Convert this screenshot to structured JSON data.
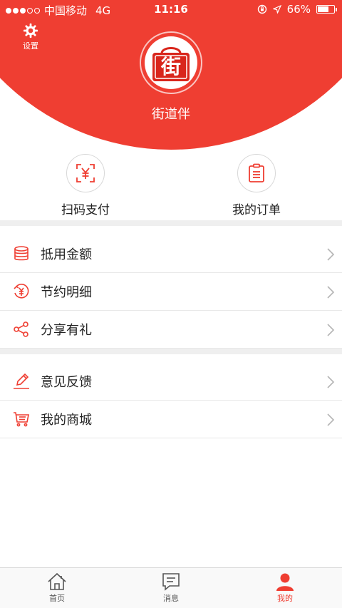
{
  "status_bar": {
    "carrier": "中国移动",
    "network": "4G",
    "time": "11:16",
    "battery": "66%",
    "battery_level": 0.66
  },
  "header": {
    "settings_label": "设置",
    "app_name": "街道伴",
    "logo_char": "街",
    "bg_color": "#ef3e32"
  },
  "quick_actions": [
    {
      "label": "扫码支付",
      "icon": "scan-pay-icon"
    },
    {
      "label": "我的订单",
      "icon": "order-list-icon"
    }
  ],
  "menu_group_1": [
    {
      "label": "抵用金额",
      "icon": "coins-icon"
    },
    {
      "label": "节约明细",
      "icon": "savings-icon"
    },
    {
      "label": "分享有礼",
      "icon": "share-icon"
    }
  ],
  "menu_group_2": [
    {
      "label": "意见反馈",
      "icon": "pen-icon"
    },
    {
      "label": "我的商城",
      "icon": "cart-icon"
    }
  ],
  "tabs": [
    {
      "label": "首页",
      "icon": "home-icon",
      "active": false
    },
    {
      "label": "消息",
      "icon": "message-icon",
      "active": false
    },
    {
      "label": "我的",
      "icon": "profile-icon",
      "active": true
    }
  ],
  "colors": {
    "accent": "#ef3e32"
  }
}
